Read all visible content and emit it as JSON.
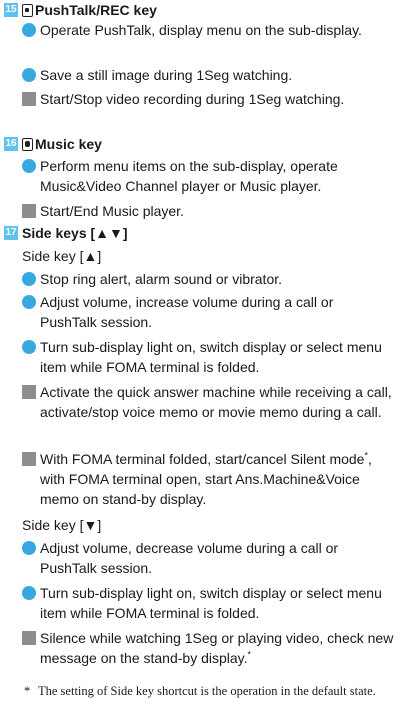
{
  "sections": {
    "s15": {
      "number": "15",
      "title": "PushTalk/REC key",
      "icon": "pushtalk-key-icon",
      "items": [
        {
          "type": "circle",
          "text": "Operate PushTalk, display menu on the sub-display."
        },
        {
          "type": "circle",
          "text": "Save a still image during 1Seg watching."
        },
        {
          "type": "square",
          "text": "Start/Stop video recording during 1Seg watching."
        }
      ]
    },
    "s16": {
      "number": "16",
      "title": "Music key",
      "icon": "music-key-icon",
      "items": [
        {
          "type": "circle",
          "text": "Perform menu items on the sub-display, operate Music&Video Channel player or Music player."
        },
        {
          "type": "square",
          "text": "Start/End Music player."
        }
      ]
    },
    "s17": {
      "number": "17",
      "title": "Side keys [▲▼]",
      "up_label": "Side key [▲]",
      "up_items": [
        {
          "type": "circle",
          "text": "Stop ring alert, alarm sound or vibrator."
        },
        {
          "type": "circle",
          "text": "Adjust volume, increase volume during a call or PushTalk session."
        },
        {
          "type": "circle",
          "text": "Turn sub-display light on, switch display or select menu item while FOMA terminal is folded."
        },
        {
          "type": "square",
          "text": "Activate the quick answer machine while receiving a call, activate/stop voice memo or movie memo during a call."
        },
        {
          "type": "square",
          "text_a": "With FOMA terminal folded, start/cancel Silent mode",
          "text_b": ", with FOMA terminal open, start Ans.Machine&Voice memo on stand-by display."
        }
      ],
      "down_label": "Side key [▼]",
      "down_items": [
        {
          "type": "circle",
          "text": "Adjust volume, decrease volume during a call or PushTalk session."
        },
        {
          "type": "circle",
          "text": "Turn sub-display light on, switch display or select menu item while FOMA terminal is folded."
        },
        {
          "type": "square",
          "text": "Silence while watching 1Seg or playing video, check new message on the stand-by display."
        }
      ]
    }
  },
  "footnote": {
    "marker": "*",
    "text": "The setting of Side key shortcut is the operation in the default state."
  },
  "colors": {
    "number_badge": "#5fc3ec",
    "circle_bullet": "#37a8e0",
    "square_bullet": "#8d8d8d"
  }
}
